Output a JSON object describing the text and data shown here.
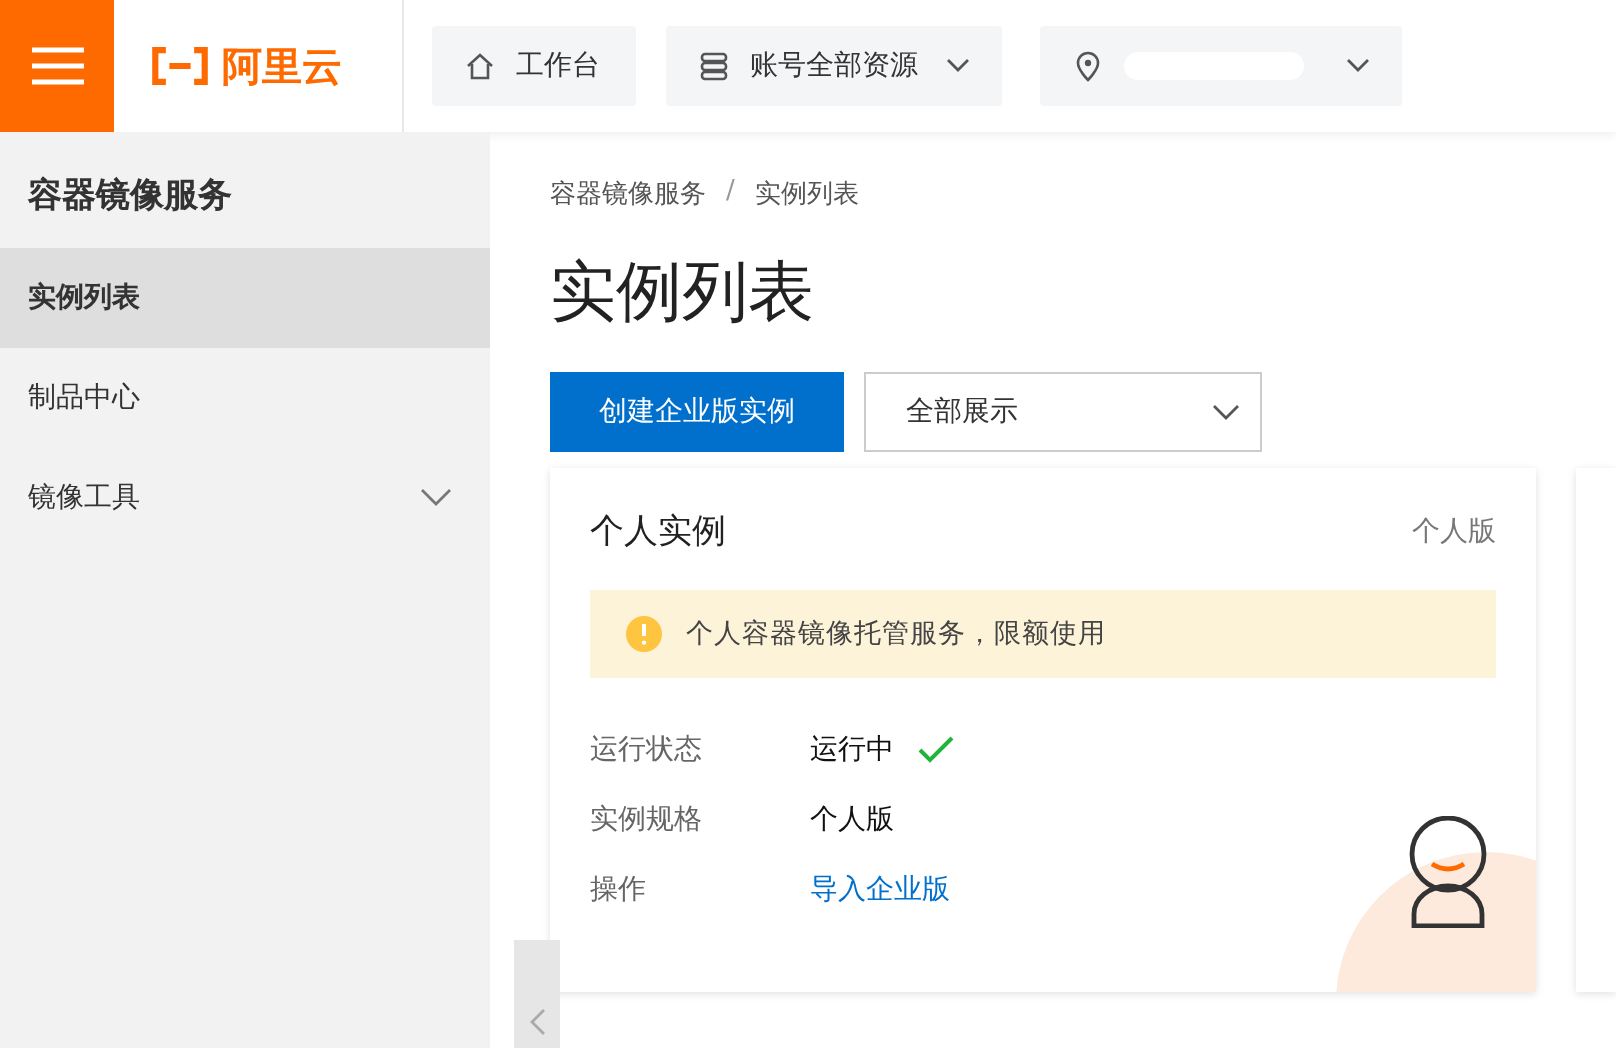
{
  "header": {
    "logo": "阿里云",
    "nav": [
      {
        "kind": "home",
        "label": "工作台"
      },
      {
        "kind": "resources",
        "label": "账号全部资源"
      },
      {
        "kind": "region"
      }
    ]
  },
  "sidebar": {
    "title": "容器镜像服务",
    "items": [
      {
        "label": "实例列表",
        "selected": true,
        "expandable": false
      },
      {
        "label": "制品中心",
        "selected": false,
        "expandable": false
      },
      {
        "label": "镜像工具",
        "selected": false,
        "expandable": true
      }
    ]
  },
  "breadcrumb": [
    "容器镜像服务",
    "实例列表"
  ],
  "breadcrumb_separator": "/",
  "page_title": "实例列表",
  "create_button": "创建企业版实例",
  "filter_select": {
    "value": "全部展示"
  },
  "card": {
    "title": "个人实例",
    "edition": "个人版",
    "notice": "个人容器镜像托管服务，限额使用",
    "fields": [
      {
        "kind": "status",
        "label": "运行状态",
        "value": "运行中"
      },
      {
        "kind": "text",
        "label": "实例规格",
        "value": "个人版"
      },
      {
        "kind": "link",
        "label": "操作",
        "value": "导入企业版"
      }
    ]
  }
}
